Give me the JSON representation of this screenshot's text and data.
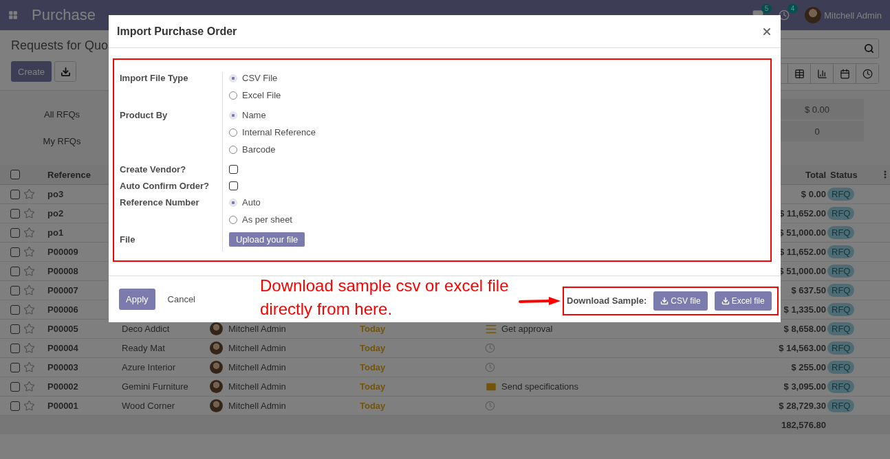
{
  "navbar": {
    "app_name": "Purchase",
    "messages_count": "5",
    "activities_count": "4",
    "user": "Mitchell Admin"
  },
  "control_panel": {
    "breadcrumb": "Requests for Quo",
    "create_button": "Create"
  },
  "dashboard": {
    "filters": [
      "All RFQs",
      "My RFQs"
    ],
    "values": [
      "$ 0.00",
      "0"
    ]
  },
  "table": {
    "select_all_checked": false,
    "columns": {
      "reference": "Reference",
      "total": "Total",
      "status": "Status"
    },
    "rows": [
      {
        "checked": false,
        "reference": "po3",
        "total": "$ 0.00",
        "status": "RFQ"
      },
      {
        "checked": false,
        "reference": "po2",
        "total": "$ 11,652.00",
        "status": "RFQ"
      },
      {
        "checked": false,
        "reference": "po1",
        "total": "$ 51,000.00",
        "status": "RFQ"
      },
      {
        "checked": false,
        "reference": "P00009",
        "total": "$ 11,652.00",
        "status": "RFQ"
      },
      {
        "checked": false,
        "reference": "P00008",
        "total": "$ 51,000.00",
        "status": "RFQ"
      },
      {
        "checked": false,
        "reference": "P00007",
        "total": "$ 637.50",
        "status": "RFQ"
      },
      {
        "checked": false,
        "reference": "P00006",
        "total": "$ 1,335.00",
        "status": "RFQ"
      },
      {
        "checked": false,
        "reference": "P00005",
        "vendor": "Deco Addict",
        "buyer": "Mitchell Admin",
        "date": "Today",
        "activity": {
          "kind": "todo",
          "text": "Get approval"
        },
        "total": "$ 8,658.00",
        "status": "RFQ"
      },
      {
        "checked": false,
        "reference": "P00004",
        "vendor": "Ready Mat",
        "buyer": "Mitchell Admin",
        "date": "Today",
        "activity": {
          "kind": "none"
        },
        "total": "$ 14,563.00",
        "status": "RFQ"
      },
      {
        "checked": false,
        "reference": "P00003",
        "vendor": "Azure Interior",
        "buyer": "Mitchell Admin",
        "date": "Today",
        "activity": {
          "kind": "none"
        },
        "total": "$ 255.00",
        "status": "RFQ"
      },
      {
        "checked": false,
        "reference": "P00002",
        "vendor": "Gemini Furniture",
        "buyer": "Mitchell Admin",
        "date": "Today",
        "activity": {
          "kind": "email",
          "text": "Send specifications"
        },
        "total": "$ 3,095.00",
        "status": "RFQ"
      },
      {
        "checked": false,
        "reference": "P00001",
        "vendor": "Wood Corner",
        "buyer": "Mitchell Admin",
        "date": "Today",
        "activity": {
          "kind": "none"
        },
        "total": "$ 28,729.30",
        "status": "RFQ"
      }
    ],
    "footer_total": "182,576.80"
  },
  "modal": {
    "title": "Import Purchase Order",
    "fields": [
      {
        "label": "Import File Type",
        "kind": "radio",
        "options": [
          {
            "label": "CSV File",
            "selected": true
          },
          {
            "label": "Excel File",
            "selected": false
          }
        ]
      },
      {
        "label": "Product By",
        "kind": "radio",
        "options": [
          {
            "label": "Name",
            "selected": true
          },
          {
            "label": "Internal Reference",
            "selected": false
          },
          {
            "label": "Barcode",
            "selected": false
          }
        ]
      },
      {
        "label": "Create Vendor?",
        "kind": "checkbox",
        "checked": false
      },
      {
        "label": "Auto Confirm Order?",
        "kind": "checkbox",
        "checked": false
      },
      {
        "label": "Reference Number",
        "kind": "radio",
        "options": [
          {
            "label": "Auto",
            "selected": true
          },
          {
            "label": "As per sheet",
            "selected": false
          }
        ]
      },
      {
        "label": "File",
        "kind": "upload",
        "button": "Upload your file"
      }
    ],
    "apply_button": "Apply",
    "cancel_button": "Cancel",
    "download_label": "Download Sample:",
    "download_buttons": [
      "CSV file",
      "Excel file"
    ]
  },
  "annotation": {
    "text": "Download sample csv or excel file directly from here."
  }
}
